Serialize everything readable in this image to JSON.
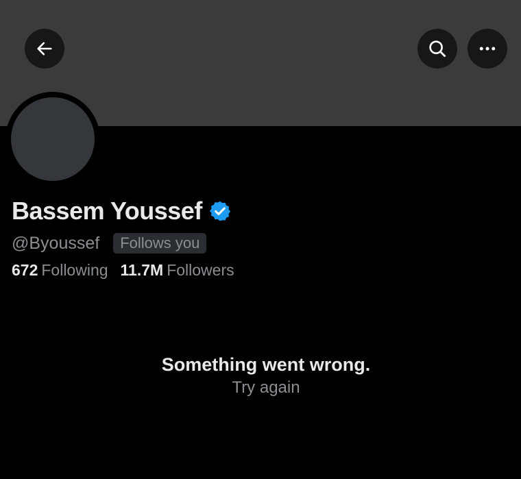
{
  "header": {
    "back_icon": "arrow-left-icon",
    "search_icon": "search-icon",
    "more_icon": "more-horizontal-icon"
  },
  "profile": {
    "display_name": "Bassem Youssef",
    "handle": "@Byoussef",
    "follows_you_badge": "Follows you",
    "verified": true,
    "verified_color": "#1d9bf0",
    "following_count": "672",
    "following_label": "Following",
    "followers_count": "11.7M",
    "followers_label": "Followers"
  },
  "error": {
    "title": "Something went wrong.",
    "retry_label": "Try again"
  },
  "colors": {
    "background": "#000000",
    "banner": "#3a3b3d",
    "primary_text": "#e7e9ea",
    "secondary_text": "#8b8f93"
  }
}
